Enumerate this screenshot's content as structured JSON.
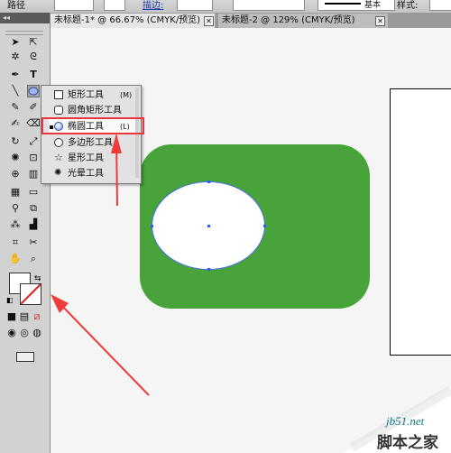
{
  "control_bar": {
    "path_label": "路径",
    "stroke_label": "描边:",
    "brush_basic_label": "基本",
    "style_label": "样式:"
  },
  "toolbox": {
    "collapse_glyph": "◂◂"
  },
  "tabs": [
    {
      "label": "未标题-1* @ 66.67% (CMYK/预览)",
      "active": true
    },
    {
      "label": "未标题-2 @ 129% (CMYK/预览)",
      "active": false
    }
  ],
  "tab_close_glyph": "✕",
  "flyout": {
    "items": [
      {
        "label": "矩形工具",
        "shortcut": "(M)",
        "icon": "rectangle-icon"
      },
      {
        "label": "圆角矩形工具",
        "shortcut": "",
        "icon": "rounded-rectangle-icon"
      },
      {
        "label": "椭圆工具",
        "shortcut": "(L)",
        "icon": "ellipse-icon",
        "selected": true
      },
      {
        "label": "多边形工具",
        "shortcut": "",
        "icon": "polygon-icon"
      },
      {
        "label": "星形工具",
        "shortcut": "",
        "icon": "star-icon"
      },
      {
        "label": "光晕工具",
        "shortcut": "",
        "icon": "flare-icon"
      }
    ]
  },
  "colors": {
    "shape_fill": "#47a33a",
    "highlight": "#e8363a",
    "arrow": "#ee3b3b",
    "selection": "#2a5cff"
  },
  "watermark": {
    "url": "jb51.net",
    "text": "脚本之家"
  }
}
